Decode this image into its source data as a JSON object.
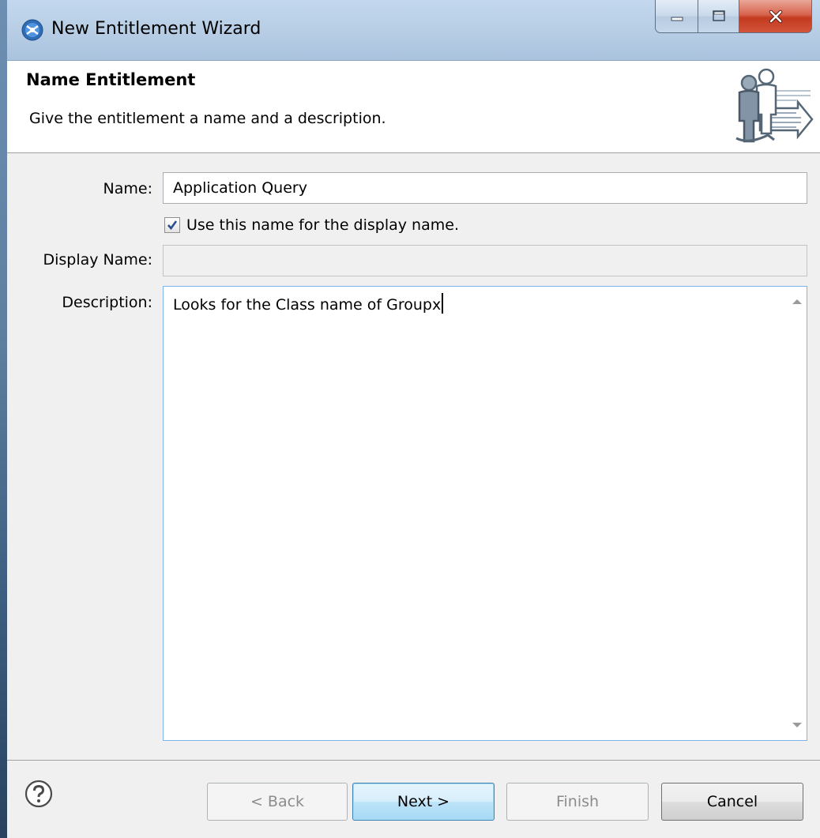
{
  "window": {
    "title": "New Entitlement Wizard"
  },
  "header": {
    "title": "Name Entitlement",
    "description": "Give the entitlement a name and a description."
  },
  "form": {
    "name_label": "Name:",
    "name_value": "Application Query",
    "use_name_checked": true,
    "use_name_label": "Use this name for the display name.",
    "display_name_label": "Display Name:",
    "display_name_value": "",
    "description_label": "Description:",
    "description_value": "Looks for the Class name of Groupx"
  },
  "buttons": {
    "back": "< Back",
    "next": "Next >",
    "finish": "Finish",
    "cancel": "Cancel"
  },
  "colors": {
    "titlebar": "#b9cfe6",
    "close_button": "#c33a1f",
    "default_button": "#a7d9f5",
    "focus_border": "#7eb4ea"
  }
}
